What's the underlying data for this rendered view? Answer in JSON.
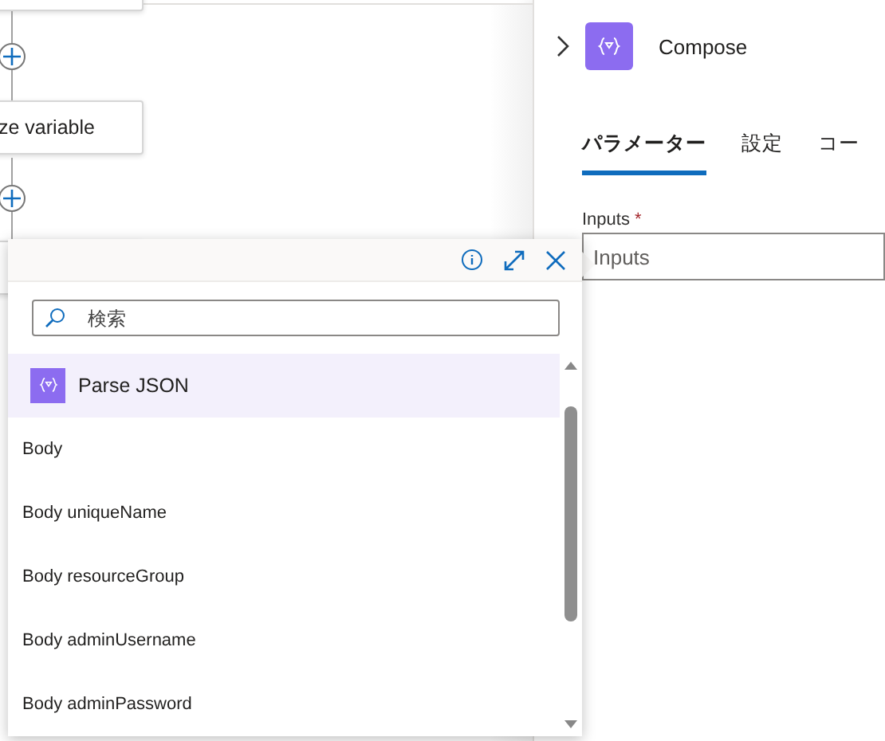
{
  "canvas": {
    "nodes": [
      {
        "kind": "card"
      },
      {
        "kind": "step",
        "title": "ze variable"
      },
      {
        "kind": "card"
      }
    ]
  },
  "panel": {
    "title": "Compose",
    "tabs": [
      {
        "label": "パラメーター",
        "selected": true
      },
      {
        "label": "設定",
        "selected": false
      },
      {
        "label": "コー",
        "selected": false
      }
    ],
    "field": {
      "label": "Inputs",
      "required_mark": "*",
      "placeholder": "Inputs"
    }
  },
  "picker": {
    "search": {
      "placeholder": "検索"
    },
    "group": {
      "title": "Parse JSON"
    },
    "items": [
      {
        "label": "Body"
      },
      {
        "label": "Body uniqueName"
      },
      {
        "label": "Body resourceGroup"
      },
      {
        "label": "Body adminUsername"
      },
      {
        "label": "Body adminPassword"
      }
    ]
  }
}
